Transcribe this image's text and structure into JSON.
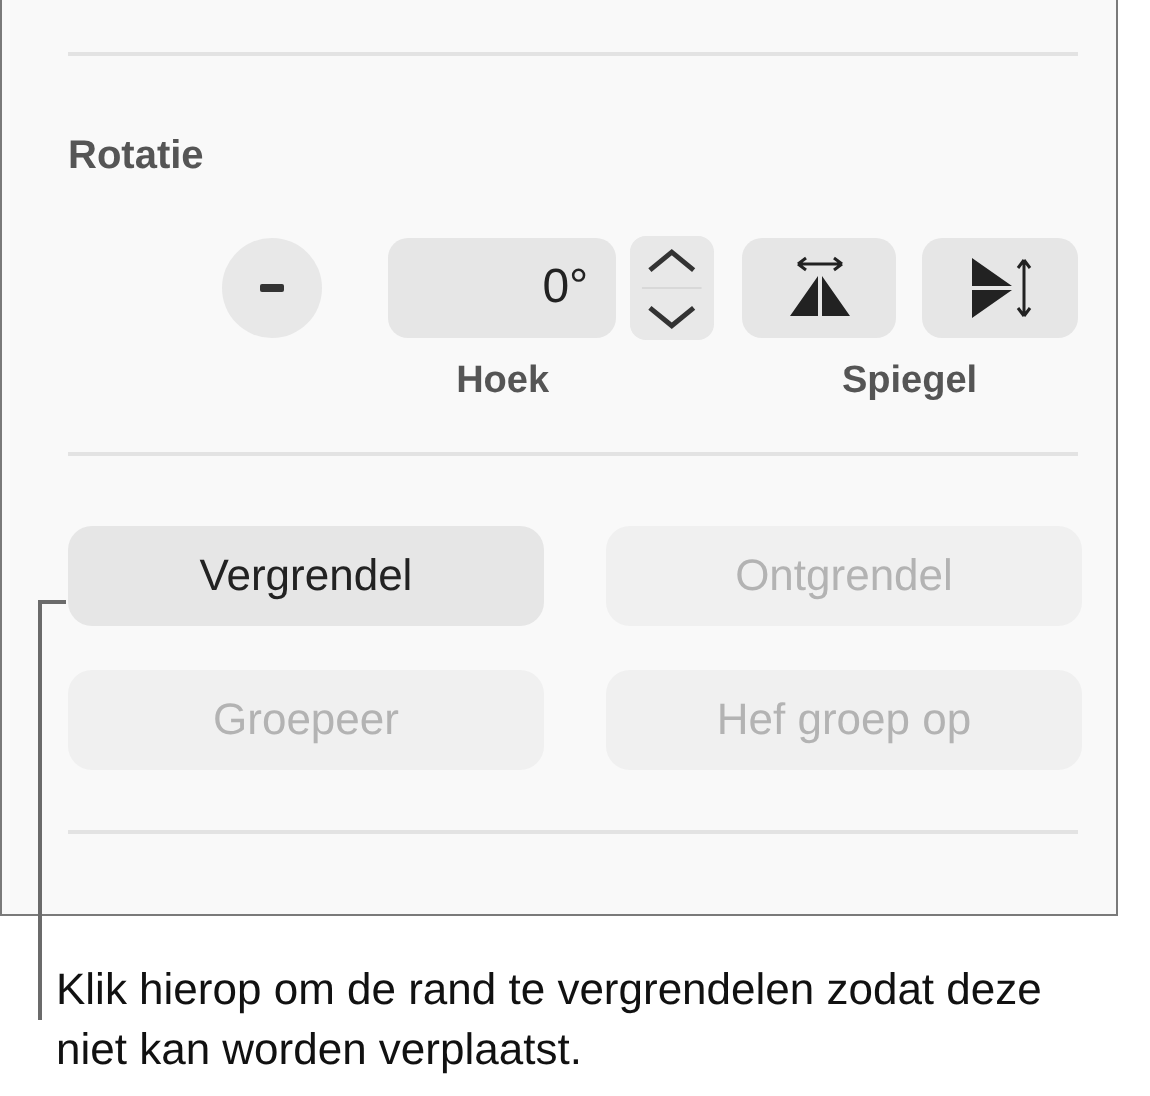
{
  "section": {
    "title": "Rotatie"
  },
  "rotation": {
    "angle_value": "0°",
    "angle_label": "Hoek",
    "mirror_label": "Spiegel"
  },
  "buttons": [
    {
      "label": "Vergrendel",
      "disabled": false
    },
    {
      "label": "Ontgrendel",
      "disabled": true
    },
    {
      "label": "Groepeer",
      "disabled": true
    },
    {
      "label": "Hef groep op",
      "disabled": true
    }
  ],
  "callout": {
    "text": "Klik hierop om de rand te vergrendelen zodat deze niet kan worden verplaatst."
  }
}
